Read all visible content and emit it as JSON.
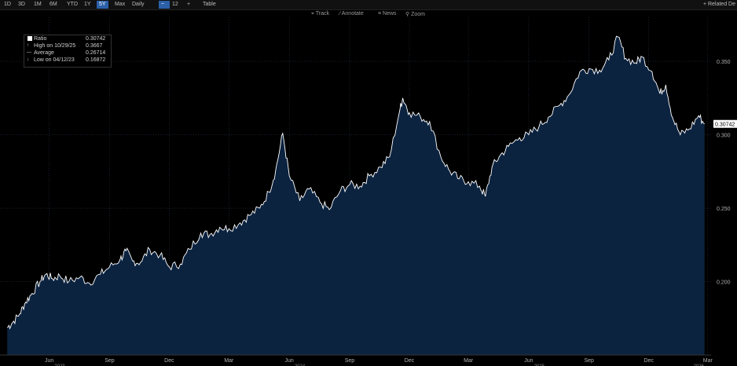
{
  "toolbar": {
    "ranges": [
      "1D",
      "3D",
      "1M",
      "6M",
      "YTD",
      "1Y",
      "5Y",
      "Max"
    ],
    "active_range": "5Y",
    "frequency": "Daily",
    "chart_icon": "line-chart-icon",
    "compare_value": "12",
    "add_symbol": "+",
    "table_label": "Table",
    "related_label": "+ Related De"
  },
  "chart_tools": [
    "Track",
    "Annotate",
    "News",
    "Zoom"
  ],
  "legend": {
    "series_label": "Ratio",
    "series_value": "0.30742",
    "high_label": "High on 10/29/25",
    "high_value": "0.3667",
    "avg_label": "Average",
    "avg_value": "0.26714",
    "low_label": "Low on 04/12/23",
    "low_value": "0.16872"
  },
  "colors": {
    "area_fill": "#0c2340",
    "line": "#ffffff",
    "grid": "#28364a",
    "background": "#000000"
  },
  "chart_data": {
    "type": "area",
    "title": "",
    "xlabel": "",
    "ylabel": "",
    "ylim": [
      0.15,
      0.38
    ],
    "y_ticks": [
      0.2,
      0.25,
      0.3,
      0.35
    ],
    "y_tick_labels": [
      "0.200",
      "0.250",
      "0.300",
      "0.350"
    ],
    "x_ticks": [
      "Jun",
      "Sep",
      "Dec",
      "Mar",
      "Jun",
      "Sep",
      "Dec",
      "Mar",
      "Jun",
      "Sep",
      "Dec",
      "Mar"
    ],
    "year_labels": [
      "2023",
      "2024",
      "2025",
      "2026"
    ],
    "last_value": "0.30742",
    "series": [
      {
        "name": "Ratio",
        "points": [
          [
            "2023-04-12",
            0.1687
          ],
          [
            "2023-04-20",
            0.172
          ],
          [
            "2023-05-01",
            0.178
          ],
          [
            "2023-05-10",
            0.186
          ],
          [
            "2023-05-20",
            0.192
          ],
          [
            "2023-06-01",
            0.2
          ],
          [
            "2023-06-10",
            0.205
          ],
          [
            "2023-06-20",
            0.202
          ],
          [
            "2023-07-01",
            0.204
          ],
          [
            "2023-07-15",
            0.2
          ],
          [
            "2023-08-01",
            0.203
          ],
          [
            "2023-08-15",
            0.199
          ],
          [
            "2023-09-01",
            0.205
          ],
          [
            "2023-09-15",
            0.21
          ],
          [
            "2023-10-01",
            0.215
          ],
          [
            "2023-10-10",
            0.221
          ],
          [
            "2023-10-20",
            0.214
          ],
          [
            "2023-11-01",
            0.213
          ],
          [
            "2023-11-15",
            0.222
          ],
          [
            "2023-12-01",
            0.218
          ],
          [
            "2023-12-15",
            0.21
          ],
          [
            "2024-01-01",
            0.212
          ],
          [
            "2024-01-15",
            0.222
          ],
          [
            "2024-02-01",
            0.233
          ],
          [
            "2024-02-15",
            0.232
          ],
          [
            "2024-03-01",
            0.237
          ],
          [
            "2024-03-15",
            0.236
          ],
          [
            "2024-04-01",
            0.24
          ],
          [
            "2024-04-15",
            0.245
          ],
          [
            "2024-05-01",
            0.25
          ],
          [
            "2024-05-15",
            0.261
          ],
          [
            "2024-05-25",
            0.275
          ],
          [
            "2024-06-05",
            0.301
          ],
          [
            "2024-06-15",
            0.272
          ],
          [
            "2024-07-01",
            0.255
          ],
          [
            "2024-07-15",
            0.263
          ],
          [
            "2024-08-01",
            0.254
          ],
          [
            "2024-08-15",
            0.249
          ],
          [
            "2024-09-01",
            0.262
          ],
          [
            "2024-09-15",
            0.266
          ],
          [
            "2024-10-01",
            0.265
          ],
          [
            "2024-10-15",
            0.272
          ],
          [
            "2024-11-01",
            0.278
          ],
          [
            "2024-11-15",
            0.285
          ],
          [
            "2024-12-01",
            0.318
          ],
          [
            "2024-12-05",
            0.325
          ],
          [
            "2024-12-15",
            0.315
          ],
          [
            "2025-01-01",
            0.312
          ],
          [
            "2025-01-15",
            0.309
          ],
          [
            "2025-02-01",
            0.285
          ],
          [
            "2025-02-15",
            0.275
          ],
          [
            "2025-03-01",
            0.27
          ],
          [
            "2025-03-15",
            0.268
          ],
          [
            "2025-04-01",
            0.265
          ],
          [
            "2025-04-10",
            0.258
          ],
          [
            "2025-04-20",
            0.278
          ],
          [
            "2025-05-01",
            0.285
          ],
          [
            "2025-05-15",
            0.292
          ],
          [
            "2025-06-01",
            0.298
          ],
          [
            "2025-06-15",
            0.3
          ],
          [
            "2025-07-01",
            0.306
          ],
          [
            "2025-07-15",
            0.312
          ],
          [
            "2025-08-01",
            0.32
          ],
          [
            "2025-08-15",
            0.327
          ],
          [
            "2025-09-01",
            0.343
          ],
          [
            "2025-09-15",
            0.345
          ],
          [
            "2025-10-01",
            0.344
          ],
          [
            "2025-10-15",
            0.351
          ],
          [
            "2025-10-29",
            0.3667
          ],
          [
            "2025-11-10",
            0.352
          ],
          [
            "2025-11-25",
            0.349
          ],
          [
            "2025-12-05",
            0.353
          ],
          [
            "2025-12-20",
            0.343
          ],
          [
            "2026-01-01",
            0.328
          ],
          [
            "2026-01-10",
            0.334
          ],
          [
            "2026-01-20",
            0.312
          ],
          [
            "2026-02-01",
            0.3
          ],
          [
            "2026-02-15",
            0.304
          ],
          [
            "2026-03-01",
            0.313
          ],
          [
            "2026-03-10",
            0.3074
          ]
        ]
      }
    ]
  }
}
